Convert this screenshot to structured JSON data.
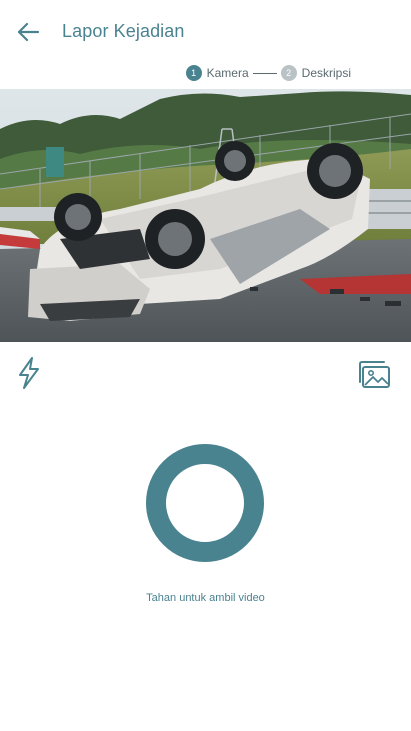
{
  "header": {
    "title": "Lapor Kejadian"
  },
  "stepper": {
    "steps": [
      {
        "number": "1",
        "label": "Kamera",
        "state": "active"
      },
      {
        "number": "2",
        "label": "Deskripsi",
        "state": "inactive"
      }
    ]
  },
  "camera": {
    "preview_subject": "overturned white car on race track"
  },
  "controls": {
    "flash_icon": "flash-icon",
    "gallery_icon": "gallery-icon"
  },
  "record": {
    "hint": "Tahan untuk ambil video"
  },
  "colors": {
    "accent": "#4a8390",
    "inactive": "#b9c3c6",
    "text_secondary": "#5a6b70"
  }
}
